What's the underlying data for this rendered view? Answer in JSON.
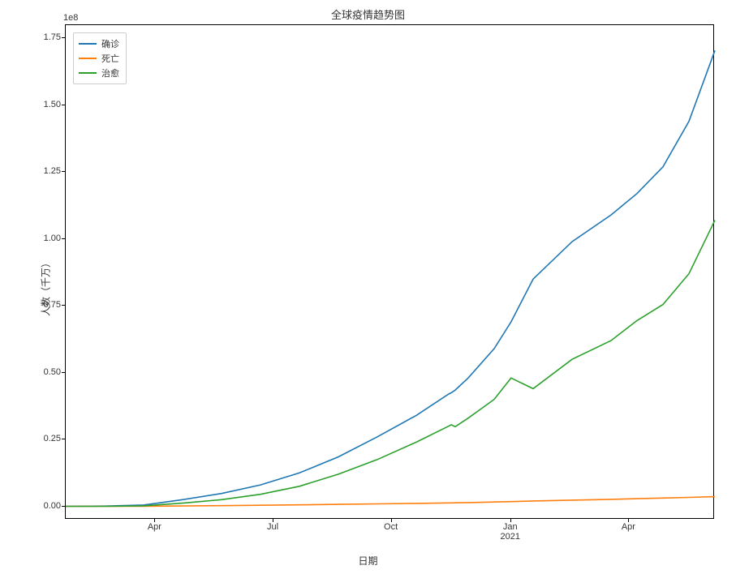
{
  "chart_data": {
    "type": "line",
    "title": "全球疫情趋势图",
    "xlabel": "日期",
    "ylabel": "人数（千万）",
    "y_exponent_label": "1e8",
    "ylim": [
      -0.05,
      1.8
    ],
    "yticks": [
      0.0,
      0.25,
      0.5,
      0.75,
      1.0,
      1.25,
      1.5,
      1.75
    ],
    "ytick_labels": [
      "0.00",
      "0.25",
      "0.50",
      "0.75",
      "1.00",
      "1.25",
      "1.50",
      "1.75"
    ],
    "x_range_days": [
      0,
      500
    ],
    "xticks_days": [
      69,
      160,
      251,
      343,
      434
    ],
    "xtick_labels": [
      "Apr",
      "Jul",
      "Oct",
      "Jan\n2021",
      "Apr"
    ],
    "colors": {
      "确诊": "#1f77b4",
      "死亡": "#ff7f0e",
      "治愈": "#2ca02c"
    },
    "legend": [
      "确诊",
      "死亡",
      "治愈"
    ],
    "x_days": [
      0,
      30,
      60,
      90,
      120,
      150,
      180,
      210,
      240,
      270,
      295,
      297,
      300,
      310,
      330,
      343,
      360,
      390,
      420,
      440,
      460,
      480,
      500
    ],
    "series": [
      {
        "name": "确诊",
        "values_1e8": [
          0.0,
          0.001,
          0.005,
          0.025,
          0.048,
          0.08,
          0.125,
          0.185,
          0.26,
          0.34,
          0.42,
          0.425,
          0.435,
          0.48,
          0.59,
          0.69,
          0.85,
          0.99,
          1.09,
          1.17,
          1.27,
          1.44,
          1.705
        ]
      },
      {
        "name": "死亡",
        "values_1e8": [
          0.0,
          0.0,
          0.0003,
          0.0014,
          0.0026,
          0.004,
          0.0055,
          0.0072,
          0.009,
          0.011,
          0.0127,
          0.0128,
          0.013,
          0.014,
          0.016,
          0.0175,
          0.02,
          0.023,
          0.026,
          0.0285,
          0.031,
          0.0335,
          0.036
        ]
      },
      {
        "name": "治愈",
        "values_1e8": [
          0.0,
          0.0,
          0.002,
          0.012,
          0.025,
          0.045,
          0.075,
          0.12,
          0.175,
          0.24,
          0.3,
          0.305,
          0.298,
          0.33,
          0.4,
          0.48,
          0.44,
          0.55,
          0.62,
          0.695,
          0.755,
          0.87,
          1.07
        ]
      }
    ]
  }
}
